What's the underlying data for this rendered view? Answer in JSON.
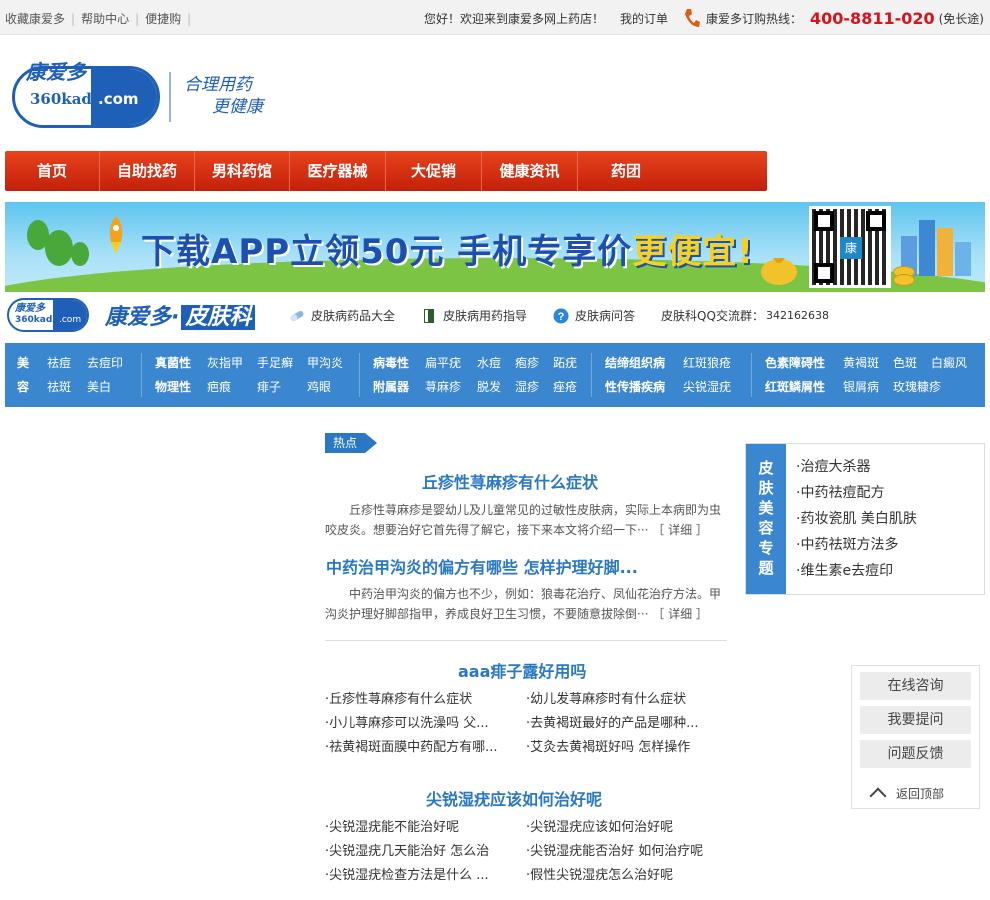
{
  "topbar": {
    "left_links": [
      "收藏康爱多",
      "帮助中心",
      "便捷购"
    ],
    "welcome": "您好！欢迎来到康爱多网上药店！",
    "my_orders": "我的订单",
    "hotline_label": "康爱多订购热线：",
    "hotline_number": "400-8811-020",
    "hotline_note": "(免长途)"
  },
  "brand": {
    "logo_top": "康爱多",
    "logo_domain_left": "360kad",
    "logo_domain_right": ".com",
    "slogan_line1": "合理用药",
    "slogan_line2": "更健康"
  },
  "main_nav": [
    "首页",
    "自助找药",
    "男科药馆",
    "医疗器械",
    "大促销",
    "健康资讯",
    "药团"
  ],
  "banner": {
    "headline_part1": "下载APP立领50元  手机专享价",
    "headline_part2": "更便宜!",
    "qr_center": "康"
  },
  "skin_header": {
    "title_main": "康爱多·",
    "title_dept": "皮肤科",
    "links": [
      "皮肤病药品大全",
      "皮肤病用药指导",
      "皮肤病问答"
    ],
    "qq_label": "皮肤科QQ交流群：",
    "qq_number": "342162638"
  },
  "categories": [
    {
      "hdr": [
        "美",
        "容"
      ],
      "rows": [
        [
          "祛痘",
          "去痘印"
        ],
        [
          "祛斑",
          "美白"
        ]
      ]
    },
    {
      "hdr": [
        "真菌性",
        "物理性"
      ],
      "rows": [
        [
          "灰指甲",
          "手足癣",
          "甲沟炎"
        ],
        [
          "疤痕",
          "痱子",
          "鸡眼"
        ]
      ]
    },
    {
      "hdr": [
        "病毒性",
        "附属器"
      ],
      "rows": [
        [
          "扁平疣",
          "水痘",
          "疱疹",
          "跖疣"
        ],
        [
          "荨麻疹",
          "脱发",
          "湿疹",
          "痤疮"
        ]
      ]
    },
    {
      "hdr": [
        "结缔组织病",
        "性传播疾病"
      ],
      "rows": [
        [
          "红斑狼疮"
        ],
        [
          "尖锐湿疣"
        ]
      ]
    },
    {
      "hdr": [
        "色素障碍性",
        "红斑鳞屑性"
      ],
      "rows": [
        [
          "黄褐斑",
          "色斑",
          "白癜风"
        ],
        [
          "银屑病",
          "玫瑰糠疹"
        ]
      ]
    }
  ],
  "hot": {
    "tag": "热点",
    "article1_title": "丘疹性荨麻疹有什么症状",
    "article1_summary": "丘疹性荨麻疹是婴幼儿及儿童常见的过敏性皮肤病，实际上本病即为虫咬皮炎。想要治好它首先得了解它，接下来本文将介绍一下···",
    "article2_title": "中药治甲沟炎的偏方有哪些  怎样护理好脚...",
    "article2_summary": "中药治甲沟炎的偏方也不少，例如：狼毒花治疗、凤仙花治疗方法。甲沟炎护理好脚部指甲，养成良好卫生习惯，不要随意拔除倒···",
    "detail_label": "［ 详细 ］"
  },
  "section1": {
    "title": "aaa痱子露好用吗",
    "left": [
      "·丘疹性荨麻疹有什么症状",
      "·小儿荨麻疹可以洗澡吗 父...",
      "·祛黄褐斑面膜中药配方有哪..."
    ],
    "right": [
      "·幼儿发荨麻疹时有什么症状",
      "·去黄褐斑最好的产品是哪种...",
      "·艾灸去黄褐斑好吗 怎样操作"
    ]
  },
  "section2": {
    "title": "尖锐湿疣应该如何治好呢",
    "left": [
      "·尖锐湿疣能不能治好呢",
      "·尖锐湿疣几天能治好 怎么治",
      "·尖锐湿疣检查方法是什么 ..."
    ],
    "right": [
      "·尖锐湿疣应该如何治好呢",
      "·尖锐湿疣能否治好 如何治疗呢",
      "·假性尖锐湿疣怎么治好呢"
    ]
  },
  "special": {
    "tab": "皮肤美容专题",
    "items": [
      "·治痘大杀器",
      "·中药祛痘配方",
      "·药妆瓷肌 美白肌肤",
      "·中药祛斑方法多",
      "·维生素e去痘印"
    ]
  },
  "service": {
    "buttons": [
      "在线咨询",
      "我要提问",
      "问题反馈"
    ],
    "back_top": "返回顶部"
  },
  "colors": {
    "nav_red": "#d8341a",
    "brand_blue": "#1e5fb8",
    "link_blue": "#2a77c4",
    "hotline_red": "#d8121b"
  }
}
